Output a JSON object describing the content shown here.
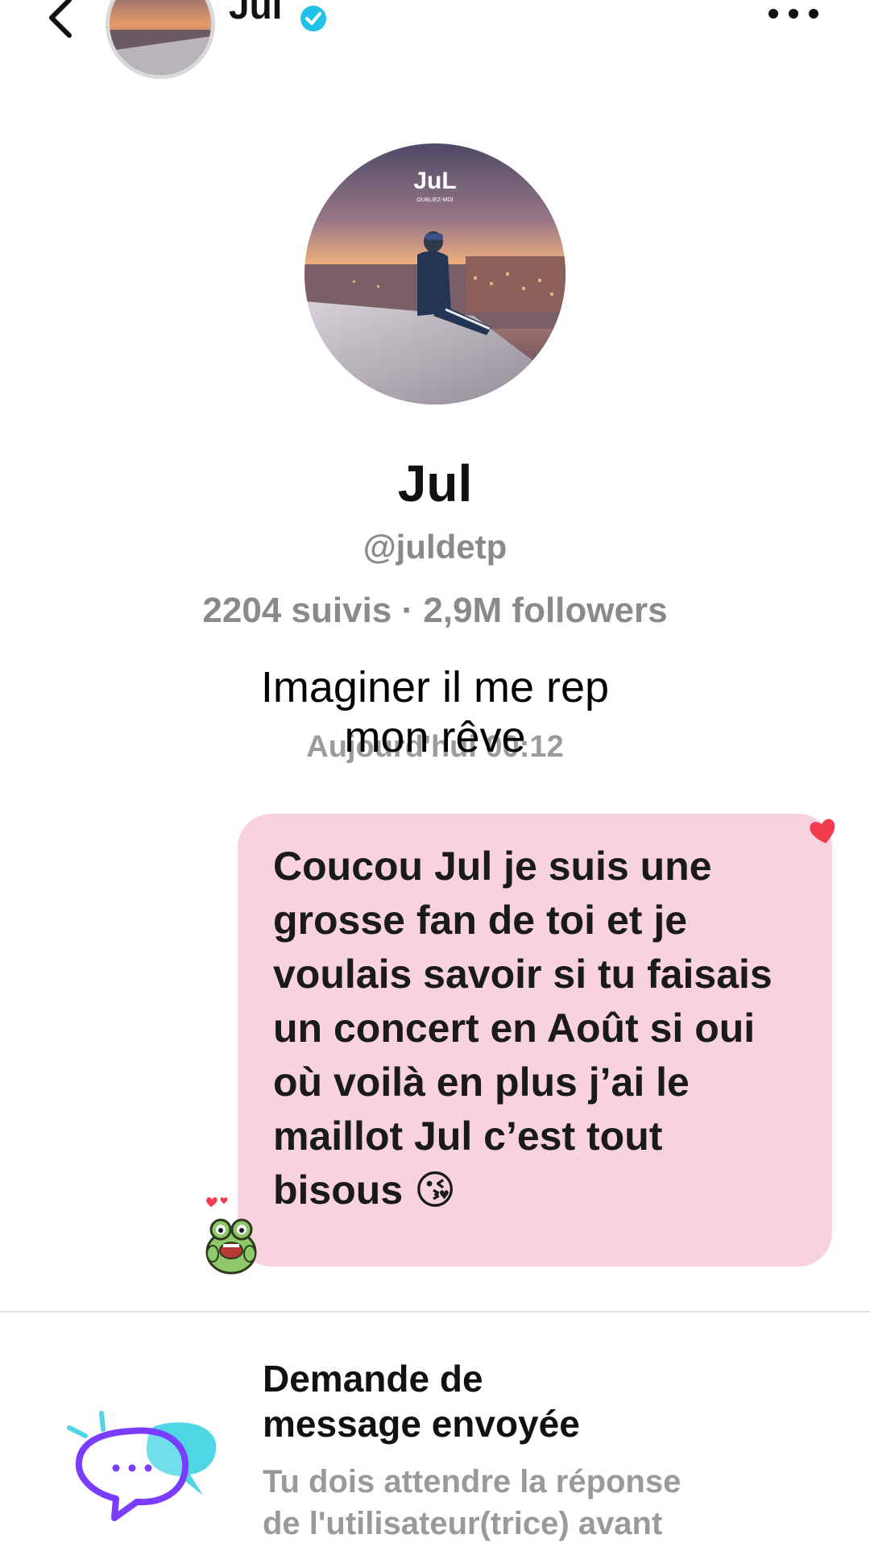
{
  "header": {
    "name": "Jul",
    "verified": true
  },
  "profile": {
    "avatar_brand_text": "JuL",
    "avatar_sub_text": "OUBLIEZ-MOI",
    "name": "Jul",
    "handle": "@juldetp",
    "stats": "2204 suivis · 2,9M followers"
  },
  "overlay_caption": "Imaginer il me rep\nmon rêve",
  "conversation": {
    "timestamp": "Aujourd'hui 00:12",
    "message": {
      "text": "Coucou Jul je suis une\ngrosse fan de toi et je\nvoulais savoir si tu faisais\nun concert en Août si oui\noù voilà en plus j’ai le\nmaillot Jul c’est tout\nbisous 😘",
      "bubble_color": "#f8d3df",
      "reaction_icon": "heart-icon",
      "sticker_icon": "frog-sticker-icon"
    }
  },
  "request": {
    "title": "Demande de\nmessage envoyée",
    "description": "Tu dois attendre la réponse\nde l'utilisateur(trice) avant"
  },
  "colors": {
    "verified_blue": "#20c2e8",
    "heart_red": "#f23d4f",
    "request_icon_purple": "#7a3cff",
    "request_icon_cyan": "#4fd6e4",
    "muted_text": "#8a8a8a"
  }
}
